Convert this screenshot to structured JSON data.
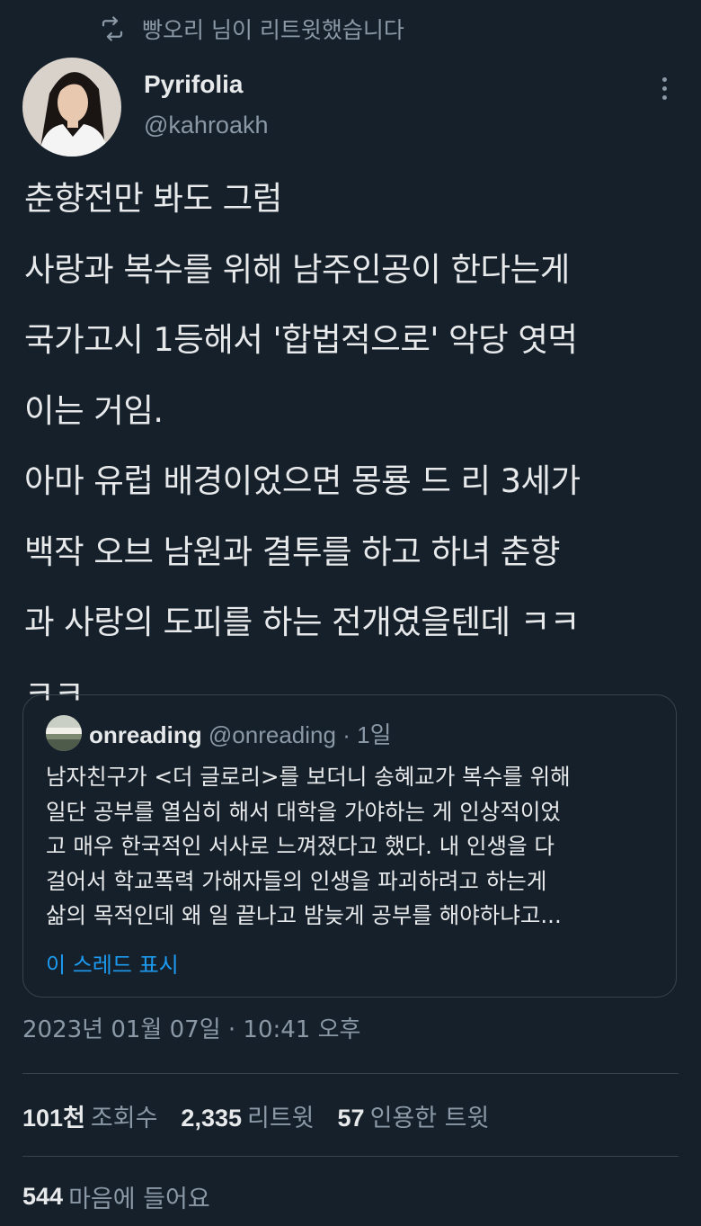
{
  "retweet_context": {
    "text": "빵오리 님이 리트윗했습니다"
  },
  "author": {
    "display_name": "Pyrifolia",
    "handle": "@kahroakh"
  },
  "tweet": {
    "lines": [
      "춘향전만 봐도 그럼",
      "사랑과 복수를 위해 남주인공이 한다는게",
      "국가고시 1등해서 '합법적으로' 악당 엿먹",
      "이는 거임.",
      "아마 유럽 배경이었으면 몽룡 드 리 3세가",
      "백작 오브 남원과 결투를 하고 하녀 춘향",
      "과 사랑의 도피를 하는 전개였을텐데 ㅋㅋ",
      "ㅋㅋ"
    ]
  },
  "quote": {
    "name": "onreading",
    "handle": "@onreading",
    "separator": "·",
    "time": "1일",
    "lines": [
      "남자친구가 <더 글로리>를 보더니 송혜교가 복수를 위해",
      "일단 공부를 열심히 해서 대학을 가야하는 게 인상적이었",
      "고 매우 한국적인 서사로 느껴졌다고 했다. 내 인생을 다",
      "걸어서 학교폭력 가해자들의 인생을 파괴하려고 하는게",
      "삶의 목적인데 왜 일 끝나고 밤늦게 공부를 해야하냐고..."
    ],
    "show_thread": "이 스레드 표시"
  },
  "timestamp": "2023년 01월 07일 · 10:41 오후",
  "stats": {
    "views_count": "101천",
    "views_label": "조회수",
    "retweets_count": "2,335",
    "retweets_label": "리트윗",
    "quotes_count": "57",
    "quotes_label": "인용한 트윗",
    "likes_count": "544",
    "likes_label": "마음에 들어요"
  },
  "colors": {
    "background": "#15202b",
    "text_primary": "#e7e9ea",
    "text_secondary": "#8b98a5",
    "link": "#1d9bf0",
    "border": "#38444d"
  },
  "icons": {
    "retweet": "retweet-icon",
    "more": "more-icon"
  }
}
